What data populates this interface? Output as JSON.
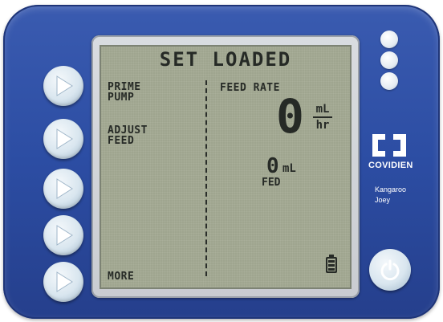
{
  "screen": {
    "title": "SET LOADED",
    "left_menu": {
      "prime_pump": "PRIME\nPUMP",
      "adjust_feed": "ADJUST\nFEED",
      "more": "MORE"
    },
    "feed_rate": {
      "label": "FEED RATE",
      "value": "0",
      "unit_top": "mL",
      "unit_bottom": "hr"
    },
    "fed": {
      "value": "0",
      "unit": "mL",
      "label": "FED"
    },
    "battery_icon": "battery-icon"
  },
  "device": {
    "brand": "COVIDIEN",
    "model": "Kangaroo\nJoey",
    "soft_keys_count": 5,
    "indicator_lights_count": 3,
    "body_color": "#2c4da3",
    "lcd_color": "#9fa58f"
  }
}
